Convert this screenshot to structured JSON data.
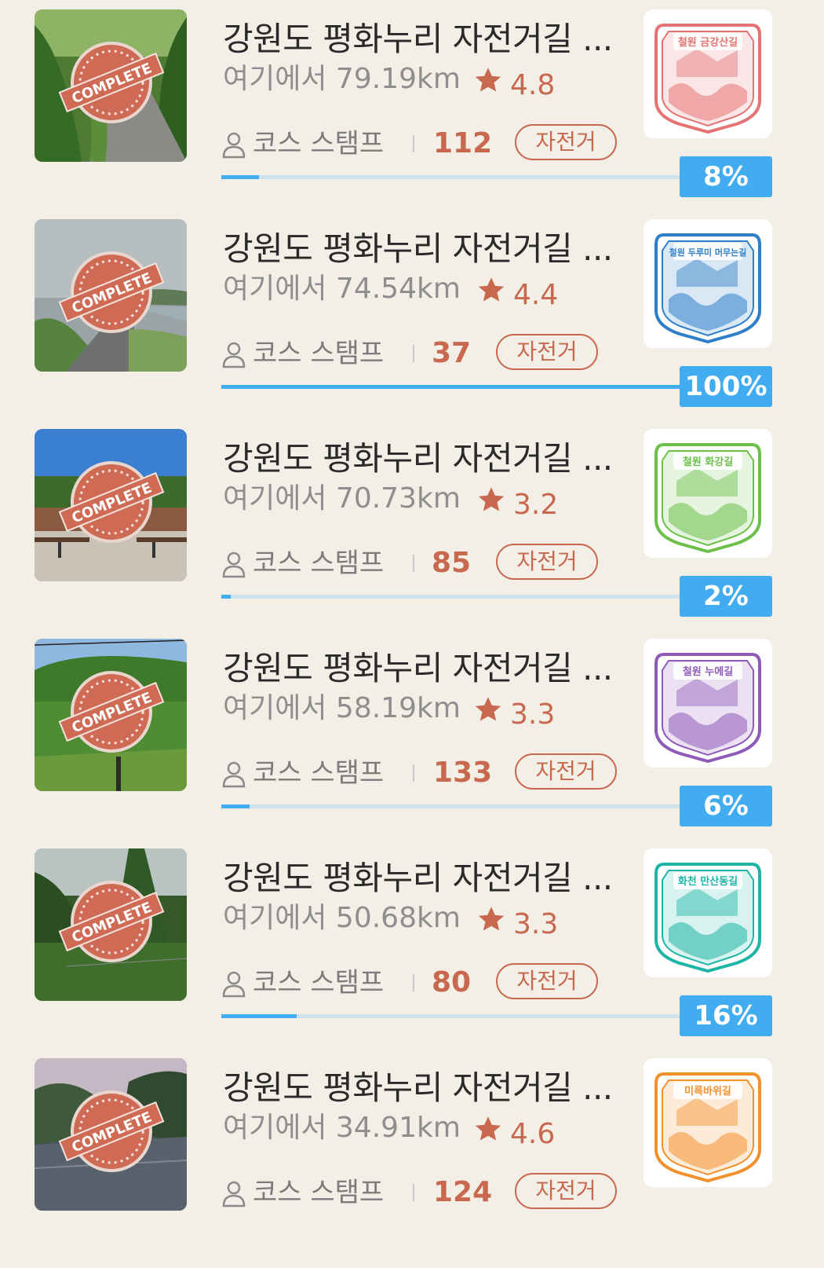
{
  "courses": [
    {
      "title": "강원도 평화누리 자전거길 ...",
      "distance": "여기에서 79.19km",
      "rating": "4.8",
      "stamp_label": "코스 스탬프",
      "stamp_count": "112",
      "tag": "자전거",
      "progress": "8%",
      "progress_value": 0.08,
      "complete_label": "COMPLETE",
      "stamp_text": "철원 금강산길",
      "stamp_color": "#e57373",
      "thumb_icon": "country-road-photo"
    },
    {
      "title": "강원도 평화누리 자전거길 ...",
      "distance": "여기에서 74.54km",
      "rating": "4.4",
      "stamp_label": "코스 스탬프",
      "stamp_count": "37",
      "tag": "자전거",
      "progress": "100%",
      "progress_value": 1.0,
      "complete_label": "COMPLETE",
      "stamp_text": "철원 두루미 머무는길",
      "stamp_color": "#2f7fc8",
      "thumb_icon": "river-path-photo"
    },
    {
      "title": "강원도 평화누리 자전거길 ...",
      "distance": "여기에서 70.73km",
      "rating": "3.2",
      "stamp_label": "코스 스탬프",
      "stamp_count": "85",
      "tag": "자전거",
      "progress": "2%",
      "progress_value": 0.02,
      "complete_label": "COMPLETE",
      "stamp_text": "철원 화강길",
      "stamp_color": "#6cc04a",
      "thumb_icon": "park-bench-photo"
    },
    {
      "title": "강원도 평화누리 자전거길 ...",
      "distance": "여기에서 58.19km",
      "rating": "3.3",
      "stamp_label": "코스 스탬프",
      "stamp_count": "133",
      "tag": "자전거",
      "progress": "6%",
      "progress_value": 0.06,
      "complete_label": "COMPLETE",
      "stamp_text": "철원 누에길",
      "stamp_color": "#8e5bb8",
      "thumb_icon": "green-hill-photo"
    },
    {
      "title": "강원도 평화누리 자전거길 ...",
      "distance": "여기에서 50.68km",
      "rating": "3.3",
      "stamp_label": "코스 스탬프",
      "stamp_count": "80",
      "tag": "자전거",
      "progress": "16%",
      "progress_value": 0.16,
      "complete_label": "COMPLETE",
      "stamp_text": "화천 만산동길",
      "stamp_color": "#1fb5a6",
      "thumb_icon": "forest-trail-photo"
    },
    {
      "title": "강원도 평화누리 자전거길 ...",
      "distance": "여기에서 34.91km",
      "rating": "4.6",
      "stamp_label": "코스 스탬프",
      "stamp_count": "124",
      "tag": "자전거",
      "progress": "",
      "progress_value": null,
      "complete_label": "COMPLETE",
      "stamp_text": "미륵바위길",
      "stamp_color": "#f2912b",
      "thumb_icon": "river-valley-photo"
    }
  ],
  "colors": {
    "accent": "#c8684f",
    "progress": "#42acf0",
    "track": "#cfe3ee",
    "background": "#f3efe6"
  }
}
